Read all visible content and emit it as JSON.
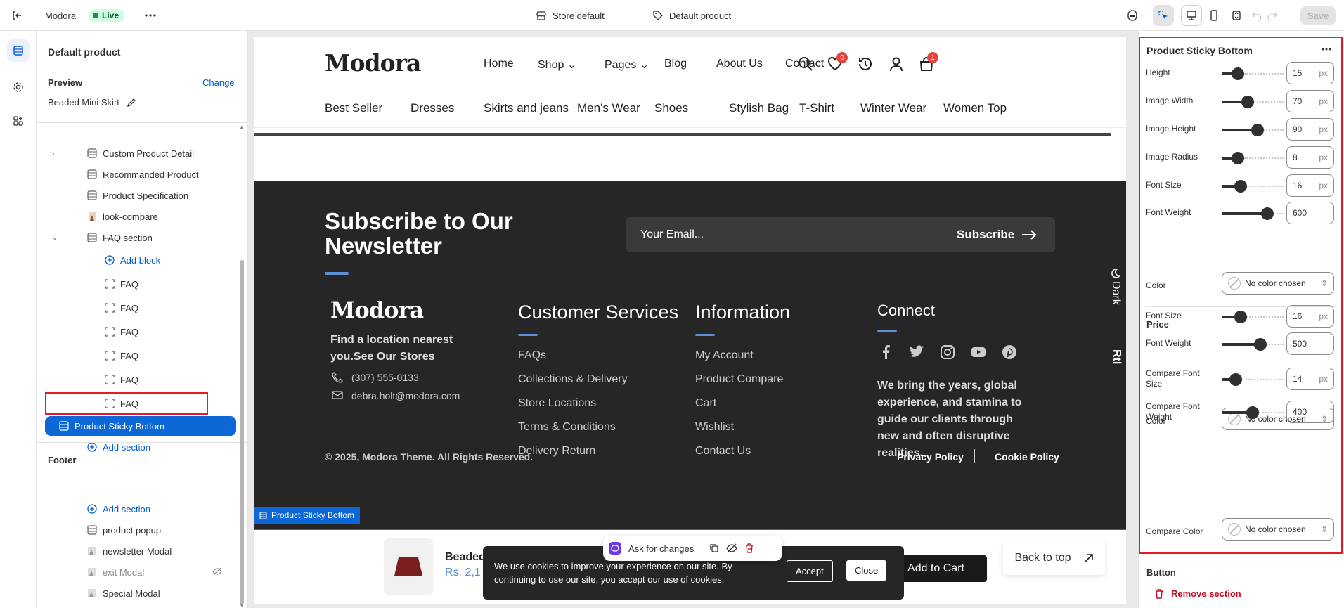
{
  "topbar": {
    "store_name": "Modora",
    "live_label": "Live",
    "store_default_label": "Store default",
    "template_label": "Default product",
    "save_label": "Save"
  },
  "sidebar": {
    "title": "Default product",
    "preview_label": "Preview",
    "change_label": "Change",
    "preview_product": "Beaded Mini Skirt",
    "items": [
      {
        "label": "Custom Product Detail"
      },
      {
        "label": "Recommanded Product"
      },
      {
        "label": "Product Specification"
      },
      {
        "label": "look-compare"
      },
      {
        "label": "FAQ section"
      },
      {
        "label": "Add block"
      },
      {
        "label": "FAQ"
      },
      {
        "label": "FAQ"
      },
      {
        "label": "FAQ"
      },
      {
        "label": "FAQ"
      },
      {
        "label": "FAQ"
      },
      {
        "label": "FAQ"
      },
      {
        "label": "Product Sticky Bottom"
      },
      {
        "label": "Add section"
      }
    ],
    "footer_title": "Footer",
    "footer_items": [
      {
        "label": "Add section"
      },
      {
        "label": "product popup"
      },
      {
        "label": "newsletter Modal"
      },
      {
        "label": "exit Modal"
      },
      {
        "label": "Special Modal"
      },
      {
        "label": "Footer"
      }
    ]
  },
  "store": {
    "logo": "Modora",
    "nav": [
      "Home",
      "Shop",
      "Pages",
      "Blog",
      "About Us",
      "Contact"
    ],
    "wishlist_count": "0",
    "cart_count": "1",
    "categories": [
      "Best Seller",
      "Dresses",
      "Skirts and jeans",
      "Men's Wear",
      "Shoes",
      "Stylish Bag",
      "T-Shirt",
      "Winter Wear",
      "Women Top"
    ],
    "newsletter_title": "Subscribe to Our Newsletter",
    "email_placeholder": "Your Email...",
    "subscribe_label": "Subscribe",
    "dark_label": "Dark",
    "rtl_label": "Rtl",
    "footer_logo": "Modora",
    "footer_tagline": "Find a location nearest you.See Our Stores",
    "phone": "(307) 555-0133",
    "email": "debra.holt@modora.com",
    "cs_title": "Customer Services",
    "cs_links": [
      "FAQs",
      "Collections & Delivery",
      "Store Locations",
      "Terms & Conditions",
      "Delivery Return"
    ],
    "info_title": "Information",
    "info_links": [
      "My Account",
      "Product Compare",
      "Cart",
      "Wishlist",
      "Contact Us"
    ],
    "connect_title": "Connect",
    "connect_text": "We bring the years, global experience, and stamina to guide our clients through new and often disruptive realities.",
    "copyright": "© 2025, Modora Theme. All Rights Reserved.",
    "privacy": "Privacy Policy",
    "cookie_policy": "Cookie Policy",
    "sticky_tag": "Product Sticky Bottom",
    "sticky_product": "Beaded",
    "sticky_price": "Rs. 2,1",
    "ask_label": "Ask for changes",
    "cookie_text": "We use cookies to improve your experience on our site. By continuing to use our site, you accept our use of cookies.",
    "accept_label": "Accept",
    "close_label": "Close",
    "add_to_cart": "Add to Cart",
    "back_to_top": "Back to top"
  },
  "panel": {
    "title": "Product Sticky Bottom",
    "fields": [
      {
        "label": "Height",
        "value": "15",
        "unit": "px",
        "level": 0.2
      },
      {
        "label": "Image Width",
        "value": "70",
        "unit": "px",
        "level": 0.4
      },
      {
        "label": "Image Height",
        "value": "90",
        "unit": "px",
        "level": 0.6
      },
      {
        "label": "Image Radius",
        "value": "8",
        "unit": "px",
        "level": 0.2
      },
      {
        "label": "Font Size",
        "value": "16",
        "unit": "px",
        "level": 0.25
      },
      {
        "label": "Font Weight",
        "value": "600",
        "unit": "",
        "level": 0.8
      }
    ],
    "color_label": "Color",
    "no_color": "No color chosen",
    "price_title": "Price",
    "price_fields": [
      {
        "label": "Font Size",
        "value": "16",
        "unit": "px",
        "level": 0.25
      },
      {
        "label": "Font Weight",
        "value": "500",
        "unit": "",
        "level": 0.65
      }
    ],
    "price_color_label": "Color",
    "compare_fields": [
      {
        "label": "Compare Font Size",
        "value": "14",
        "unit": "px",
        "level": 0.15
      },
      {
        "label": "Compare Font Weight",
        "value": "400",
        "unit": "",
        "level": 0.5
      }
    ],
    "compare_color_label": "Compare Color",
    "button_title": "Button",
    "remove_label": "Remove section"
  }
}
